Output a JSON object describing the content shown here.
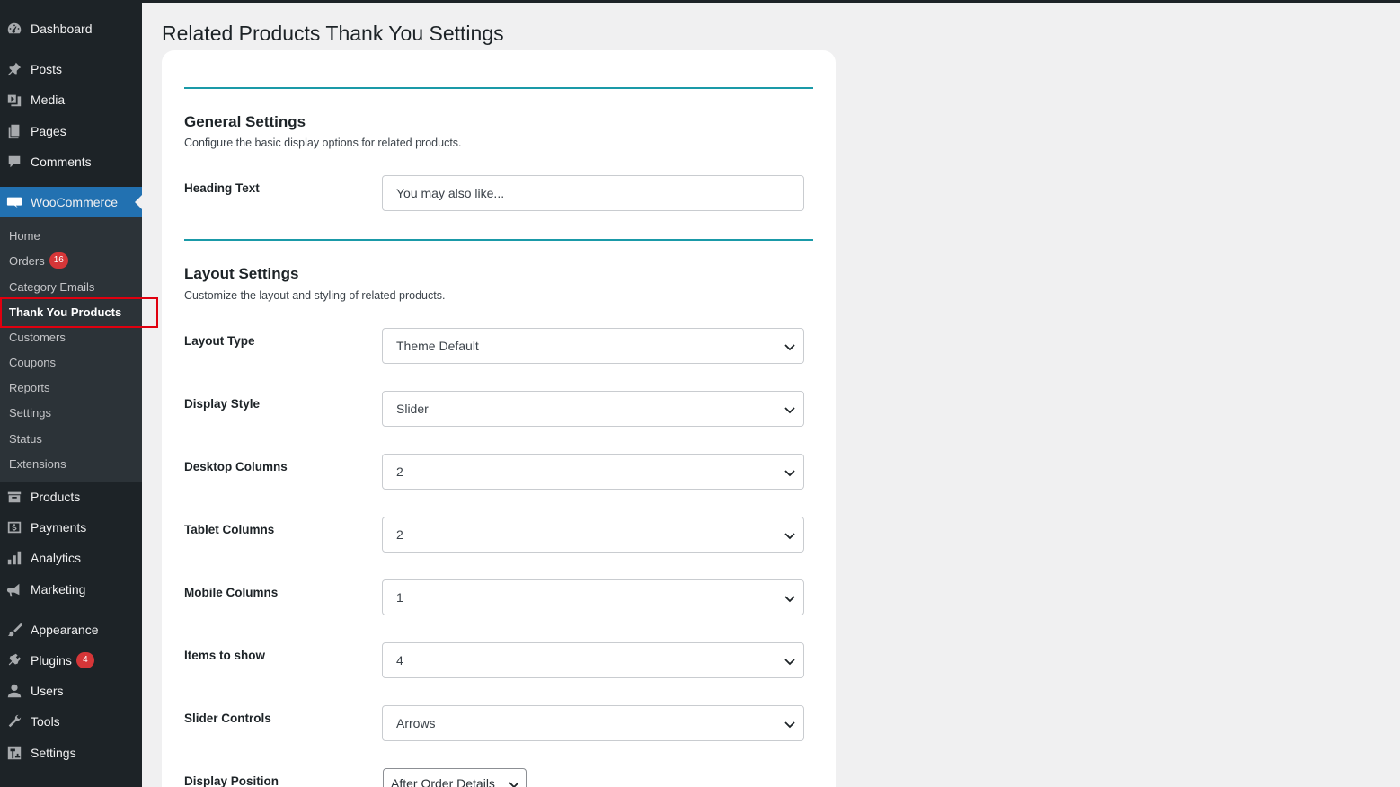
{
  "sidebar": {
    "top_items": [
      {
        "label": "Dashboard",
        "icon": "dashboard-icon"
      },
      {
        "label": "Posts",
        "icon": "pin-icon"
      },
      {
        "label": "Media",
        "icon": "media-icon"
      },
      {
        "label": "Pages",
        "icon": "pages-icon"
      },
      {
        "label": "Comments",
        "icon": "comment-icon"
      }
    ],
    "woocommerce": {
      "label": "WooCommerce",
      "icon": "woo-icon"
    },
    "submenu": [
      {
        "label": "Home"
      },
      {
        "label": "Orders",
        "badge": "16"
      },
      {
        "label": "Category Emails"
      },
      {
        "label": "Thank You Products"
      },
      {
        "label": "Customers"
      },
      {
        "label": "Coupons"
      },
      {
        "label": "Reports"
      },
      {
        "label": "Settings"
      },
      {
        "label": "Status"
      },
      {
        "label": "Extensions"
      }
    ],
    "bottom_items": [
      {
        "label": "Products",
        "icon": "products-icon"
      },
      {
        "label": "Payments",
        "icon": "payments-icon"
      },
      {
        "label": "Analytics",
        "icon": "analytics-icon"
      },
      {
        "label": "Marketing",
        "icon": "megaphone-icon"
      },
      {
        "label": "Appearance",
        "icon": "brush-icon"
      },
      {
        "label": "Plugins",
        "icon": "plugin-icon",
        "badge": "4"
      },
      {
        "label": "Users",
        "icon": "user-icon"
      },
      {
        "label": "Tools",
        "icon": "wrench-icon"
      },
      {
        "label": "Settings",
        "icon": "settings-icon"
      }
    ]
  },
  "page": {
    "title": "Related Products Thank You Settings"
  },
  "general": {
    "title": "General Settings",
    "description": "Configure the basic display options for related products.",
    "heading_text_label": "Heading Text",
    "heading_text_value": "You may also like..."
  },
  "layout": {
    "title": "Layout Settings",
    "description": "Customize the layout and styling of related products.",
    "fields": [
      {
        "label": "Layout Type",
        "value": "Theme Default"
      },
      {
        "label": "Display Style",
        "value": "Slider"
      },
      {
        "label": "Desktop Columns",
        "value": "2"
      },
      {
        "label": "Tablet Columns",
        "value": "2"
      },
      {
        "label": "Mobile Columns",
        "value": "1"
      },
      {
        "label": "Items to show",
        "value": "4"
      },
      {
        "label": "Slider Controls",
        "value": "Arrows"
      }
    ],
    "display_position": {
      "label": "Display Position",
      "value": "After Order Details"
    }
  },
  "colors": {
    "sidebar_bg": "#1d2327",
    "submenu_bg": "#2c3338",
    "active_bg": "#2271b1",
    "divider": "#1a9aa8",
    "badge": "#d63638",
    "highlight": "#e0000f"
  }
}
